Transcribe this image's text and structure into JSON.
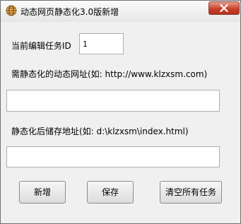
{
  "window": {
    "title": "动态网页静态化3.0版新增"
  },
  "form": {
    "task_id_label": "当前编辑任务ID",
    "task_id_value": "1",
    "dynamic_url_label": "需静态化的动态网址(如: http://www.klzxsm.com)",
    "dynamic_url_value": "",
    "static_path_label": "静态化后储存地址(如: d:\\klzxsm\\index.html)",
    "static_path_value": ""
  },
  "buttons": {
    "add_label": "新增",
    "save_label": "保存",
    "clear_all_label": "清空所有任务"
  },
  "icons": {
    "app": "globe-icon",
    "close": "close-icon"
  }
}
